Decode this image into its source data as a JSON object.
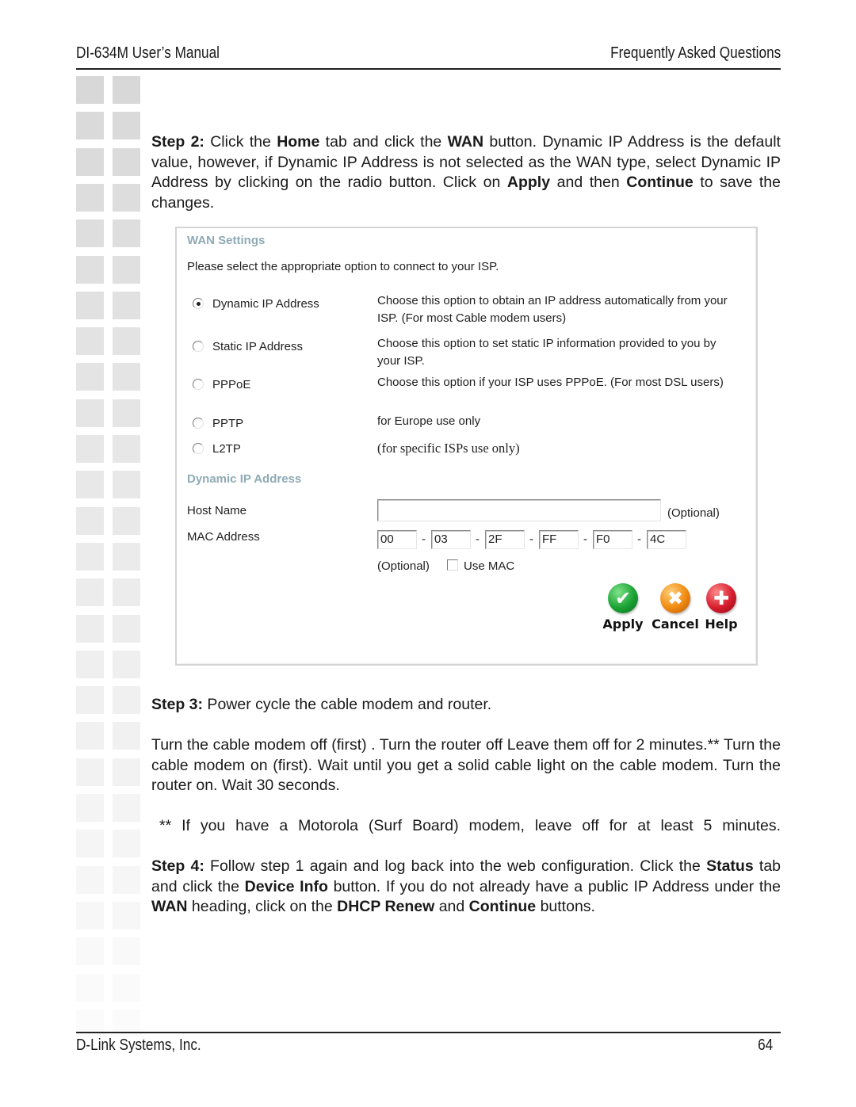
{
  "header": {
    "manual_title": "DI-634M User’s Manual",
    "section_title": "Frequently Asked Questions"
  },
  "footer": {
    "company": "D-Link Systems, Inc.",
    "page_number": "64"
  },
  "step2": {
    "label": "Step 2:",
    "t1": " Click the ",
    "b1": "Home",
    "t2": " tab and click the ",
    "b2": "WAN",
    "t3": " button. Dynamic IP Address is the default value, however, if Dynamic IP Address is not selected as the WAN type, select Dynamic IP Address by clicking on the radio button. Click on ",
    "b3": "Apply",
    "t4": " and then ",
    "b4": "Continue",
    "t5": " to save the changes."
  },
  "screenshot": {
    "wan_title": "WAN Settings",
    "intro": "Please select the appropriate option to connect to your ISP.",
    "options": [
      {
        "label": "Dynamic IP Address",
        "selected": true,
        "desc": "Choose this option to obtain an IP address automatically from your ISP. (For most Cable modem users)"
      },
      {
        "label": "Static IP Address",
        "selected": false,
        "desc": "Choose this option to set static IP information provided to you by your ISP."
      },
      {
        "label": "PPPoE",
        "selected": false,
        "desc": "Choose this option if your ISP uses PPPoE. (For most DSL users)"
      },
      {
        "label": "PPTP",
        "selected": false,
        "desc": "for Europe use only"
      },
      {
        "label": "L2TP",
        "selected": false,
        "desc": "(for specific ISPs use only)"
      }
    ],
    "dyn_title": "Dynamic IP Address",
    "host_name_label": "Host Name",
    "host_name_value": "",
    "host_optional": "(Optional)",
    "mac_label": "MAC Address",
    "mac_octets": [
      "00",
      "03",
      "2F",
      "FF",
      "F0",
      "4C"
    ],
    "mac_separator": "-",
    "mac_optional": "(Optional)",
    "use_mac_label": "Use MAC",
    "use_mac_checked": false,
    "buttons": {
      "apply": "Apply",
      "cancel": "Cancel",
      "help": "Help"
    },
    "icons": {
      "apply": "✔",
      "cancel": "✖",
      "help": "✚"
    }
  },
  "step3": {
    "label": "Step 3:",
    "text": " Power cycle the cable modem and router."
  },
  "power_cycle": "Turn the cable modem off (first) . Turn the router off Leave them off for 2 minutes.** Turn the cable modem on (first).  Wait until you get a solid cable light on the cable modem. Turn the router on. Wait 30 seconds.",
  "note": "** If you have a Motorola (Surf Board) modem, leave off for at least 5 minutes.",
  "step4": {
    "label": "Step 4:",
    "t1": " Follow step 1 again and log back into the web configuration. Click the ",
    "b1": "Status",
    "t2": " tab and click the ",
    "b2": "Device Info",
    "t3": " button. If you do not already have a public IP Address under the ",
    "b3": "WAN",
    "t4": " heading, click on the ",
    "b4": "DHCP Renew",
    "t5": " and ",
    "b5": "Continue",
    "t6": " buttons."
  }
}
